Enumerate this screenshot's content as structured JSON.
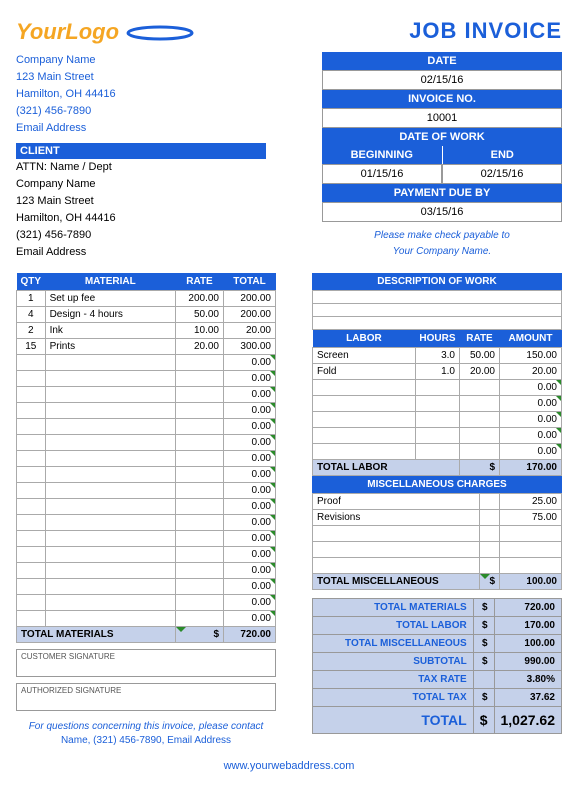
{
  "title": "JOB INVOICE",
  "logo_text": "YourLogo",
  "company": {
    "name": "Company Name",
    "street": "123 Main Street",
    "city": "Hamilton, OH  44416",
    "phone": "(321) 456-7890",
    "email": "Email Address"
  },
  "client_header": "CLIENT",
  "client": {
    "attn": "ATTN: Name / Dept",
    "name": "Company Name",
    "street": "123 Main Street",
    "city": "Hamilton, OH  44416",
    "phone": "(321) 456-7890",
    "email": "Email Address"
  },
  "headers": {
    "date": "DATE",
    "invoice_no": "INVOICE NO.",
    "date_of_work": "DATE OF WORK",
    "beginning": "BEGINNING",
    "end": "END",
    "payment_due": "PAYMENT DUE BY"
  },
  "values": {
    "date": "02/15/16",
    "invoice_no": "10001",
    "beginning": "01/15/16",
    "end": "02/15/16",
    "payment_due": "03/15/16"
  },
  "payable": {
    "l1": "Please make check payable to",
    "l2": "Your Company Name."
  },
  "mat_headers": {
    "qty": "QTY",
    "material": "MATERIAL",
    "rate": "RATE",
    "total": "TOTAL"
  },
  "materials": [
    {
      "qty": "1",
      "name": "Set up fee",
      "rate": "200.00",
      "total": "200.00"
    },
    {
      "qty": "4",
      "name": "Design - 4 hours",
      "rate": "50.00",
      "total": "200.00"
    },
    {
      "qty": "2",
      "name": "Ink",
      "rate": "10.00",
      "total": "20.00"
    },
    {
      "qty": "15",
      "name": "Prints",
      "rate": "20.00",
      "total": "300.00"
    }
  ],
  "mat_blank_rows": 17,
  "mat_total_label": "TOTAL MATERIALS",
  "mat_total": "720.00",
  "desc_header": "DESCRIPTION OF WORK",
  "desc_rows": 3,
  "labor_headers": {
    "labor": "LABOR",
    "hours": "HOURS",
    "rate": "RATE",
    "amount": "AMOUNT"
  },
  "labor": [
    {
      "name": "Screen",
      "hours": "3.0",
      "rate": "50.00",
      "amount": "150.00"
    },
    {
      "name": "Fold",
      "hours": "1.0",
      "rate": "20.00",
      "amount": "20.00"
    }
  ],
  "labor_blank_rows": 5,
  "labor_total_label": "TOTAL LABOR",
  "labor_total": "170.00",
  "misc_header": "MISCELLANEOUS CHARGES",
  "misc": [
    {
      "name": "Proof",
      "amount": "25.00"
    },
    {
      "name": "Revisions",
      "amount": "75.00"
    }
  ],
  "misc_blank_rows": 3,
  "misc_total_label": "TOTAL MISCELLANEOUS",
  "misc_total": "100.00",
  "sig": {
    "customer": "CUSTOMER SIGNATURE",
    "authorized": "AUTHORIZED SIGNATURE"
  },
  "contact": {
    "l1": "For questions concerning this invoice, please contact",
    "l2": "Name, (321) 456-7890, Email Address"
  },
  "summary": {
    "mat_l": "TOTAL MATERIALS",
    "mat_v": "720.00",
    "lab_l": "TOTAL LABOR",
    "lab_v": "170.00",
    "misc_l": "TOTAL MISCELLANEOUS",
    "misc_v": "100.00",
    "sub_l": "SUBTOTAL",
    "sub_v": "990.00",
    "tax_rate_l": "TAX RATE",
    "tax_rate_v": "3.80%",
    "tax_l": "TOTAL TAX",
    "tax_v": "37.62",
    "grand_l": "TOTAL",
    "grand_v": "1,027.62"
  },
  "currency": "$",
  "web": "www.yourwebaddress.com"
}
